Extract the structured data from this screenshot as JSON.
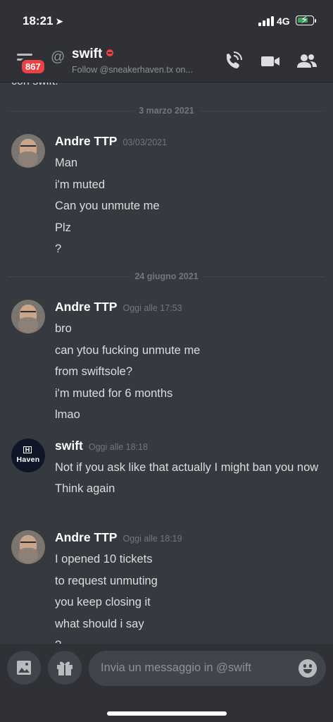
{
  "status_bar": {
    "time": "18:21",
    "network": "4G"
  },
  "header": {
    "unread_badge": "867",
    "title": "swift",
    "subtitle": "Follow @sneakerhaven.tx on..."
  },
  "chat": {
    "previous_message_tail": "con swift.",
    "dividers": [
      {
        "label": "3 marzo 2021"
      },
      {
        "label": "24 giugno 2021"
      }
    ],
    "messages": [
      {
        "author": "Andre TTP",
        "timestamp": "03/03/2021",
        "lines": [
          "Man",
          "i'm muted",
          "Can you unmute me",
          "Plz",
          "?"
        ]
      },
      {
        "author": "Andre TTP",
        "timestamp": "Oggi alle 17:53",
        "lines": [
          "bro",
          "can ytou fucking unmute me",
          "from swiftsole?",
          "i'm muted for 6 months",
          "lmao"
        ]
      },
      {
        "author": "swift",
        "avatar_text": "Haven",
        "avatar_logo_letter": "H",
        "timestamp": "Oggi alle 18:18",
        "lines": [
          "Not if you ask like that actually I might ban you now",
          "Think again"
        ]
      },
      {
        "author": "Andre TTP",
        "timestamp": "Oggi alle 18:19",
        "lines": [
          "I opened 10 tickets",
          "to request unmuting",
          "you keep closing it",
          "what should i say",
          "?"
        ]
      }
    ]
  },
  "composer": {
    "placeholder": "Invia un messaggio in @swift",
    "icons": [
      "image-icon",
      "gift-icon",
      "emoji-icon"
    ]
  },
  "colors": {
    "background": "#36393f",
    "header_bg": "#2f3136",
    "badge": "#ed4245",
    "dnd_status": "#ed4245",
    "battery_charging": "#3ba55c"
  }
}
